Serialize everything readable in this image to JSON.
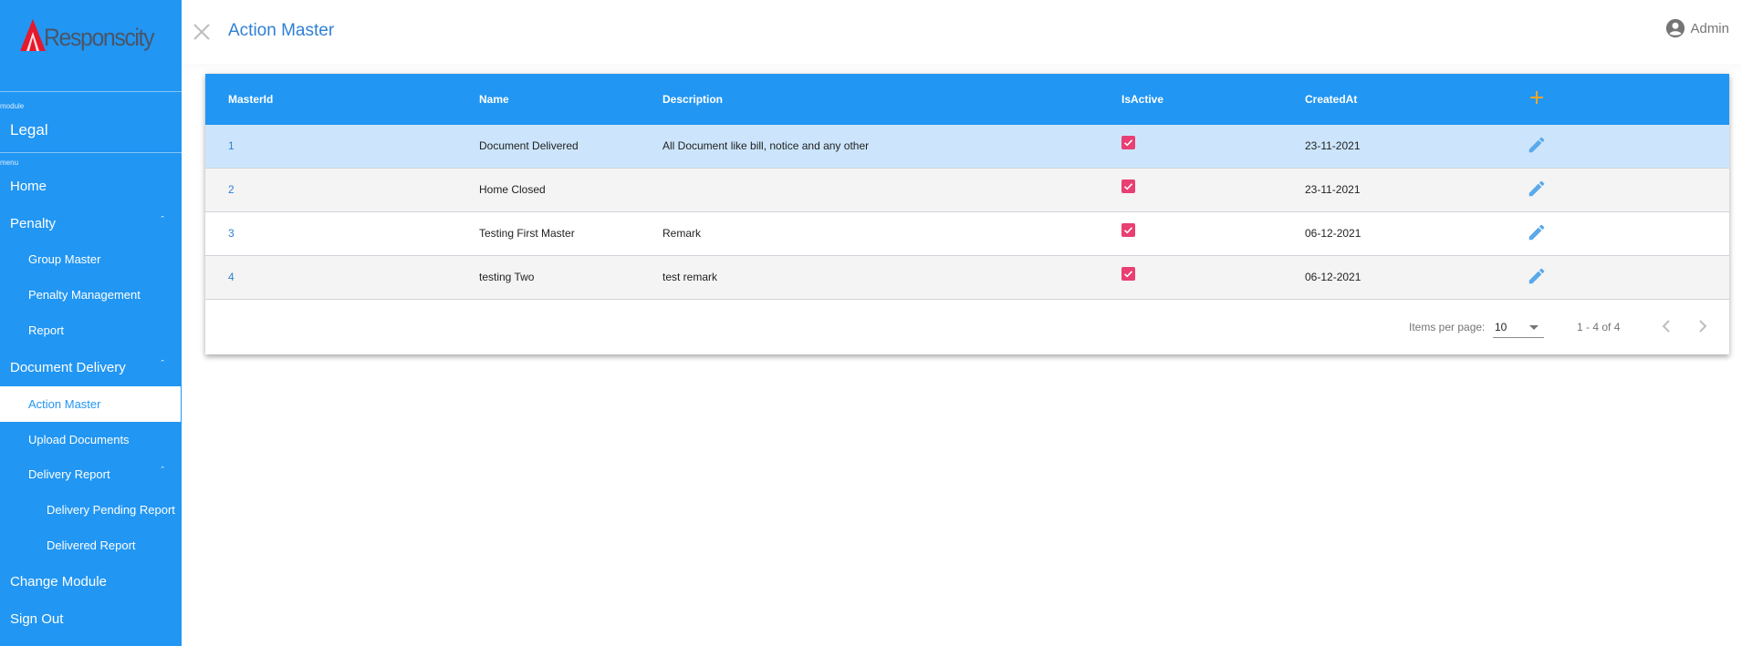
{
  "sidebar": {
    "brand": "Responscity",
    "module_label": "module",
    "module_name": "Legal",
    "menu_label": "menu",
    "items": [
      {
        "label": "Home",
        "level": 0
      },
      {
        "label": "Penalty",
        "level": 0,
        "expanded": true
      },
      {
        "label": "Group Master",
        "level": 1
      },
      {
        "label": "Penalty Management",
        "level": 1
      },
      {
        "label": "Report",
        "level": 1
      },
      {
        "label": "Document Delivery",
        "level": 0,
        "expanded": true
      },
      {
        "label": "Action Master",
        "level": 1,
        "active": true
      },
      {
        "label": "Upload Documents",
        "level": 1
      },
      {
        "label": "Delivery Report",
        "level": 1,
        "expanded": true
      },
      {
        "label": "Delivery Pending Report",
        "level": 2
      },
      {
        "label": "Delivered Report",
        "level": 2
      },
      {
        "label": "Change Module",
        "level": 0
      },
      {
        "label": "Sign Out",
        "level": 0
      }
    ],
    "caret_glyph": "ˆ"
  },
  "header": {
    "title": "Action Master",
    "close_icon": "close-icon",
    "user_name": "Admin",
    "user_icon": "account-circle-icon"
  },
  "table": {
    "columns": [
      "MasterId",
      "Name",
      "Description",
      "IsActive",
      "CreatedAt"
    ],
    "add_icon": "plus-icon",
    "rows": [
      {
        "id": "1",
        "name": "Document Delivered",
        "description": "All Document like bill, notice and any other",
        "is_active": true,
        "created_at": "23-11-2021",
        "selected": true
      },
      {
        "id": "2",
        "name": "Home Closed",
        "description": "",
        "is_active": true,
        "created_at": "23-11-2021"
      },
      {
        "id": "3",
        "name": "Testing First Master",
        "description": "Remark",
        "is_active": true,
        "created_at": "06-12-2021"
      },
      {
        "id": "4",
        "name": "testing Two",
        "description": "test remark",
        "is_active": true,
        "created_at": "06-12-2021"
      }
    ]
  },
  "paginator": {
    "items_per_page_label": "Items per page:",
    "items_per_page": "10",
    "range": "1 - 4 of 4"
  },
  "colors": {
    "primary": "#2196f3",
    "selected_row": "#cce5fc",
    "checkbox": "#e93f73",
    "add_icon": "#f5a623",
    "edit_icon": "#5aa9ea",
    "title": "#2f80d6"
  }
}
